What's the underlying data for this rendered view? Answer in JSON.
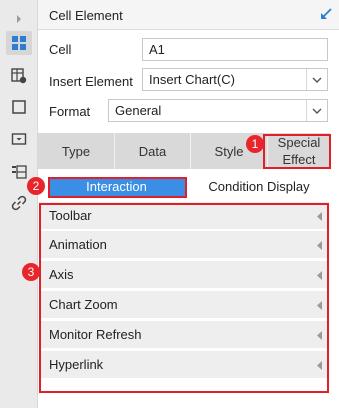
{
  "sidebar": {
    "items": [
      {
        "icon": "chevron-right-icon"
      },
      {
        "icon": "cell-element-icon",
        "active": true
      },
      {
        "icon": "cell-attribute-icon"
      },
      {
        "icon": "widget-icon"
      },
      {
        "icon": "dropdown-widget-icon"
      },
      {
        "icon": "template-dataset-icon"
      },
      {
        "icon": "link-icon"
      }
    ]
  },
  "header": {
    "title": "Cell Element",
    "pin_icon": "arrow-down-left-icon"
  },
  "cell": {
    "label": "Cell",
    "value": "A1"
  },
  "insert": {
    "label": "Insert Element",
    "value": "Insert Chart(C)"
  },
  "format": {
    "label": "Format",
    "value": "General"
  },
  "tabs": {
    "type": "Type",
    "data": "Data",
    "style": "Style",
    "special_line1": "Special",
    "special_line2": "Effect"
  },
  "subtabs": {
    "interaction": "Interaction",
    "condition": "Condition Display"
  },
  "items": [
    "Toolbar",
    "Animation",
    "Axis",
    "Chart Zoom",
    "Monitor Refresh",
    "Hyperlink"
  ],
  "badges": {
    "b1": "1",
    "b2": "2",
    "b3": "3"
  },
  "colors": {
    "accent": "#3a8ee6",
    "highlight": "#e11f26",
    "badge": "#e8252b"
  }
}
